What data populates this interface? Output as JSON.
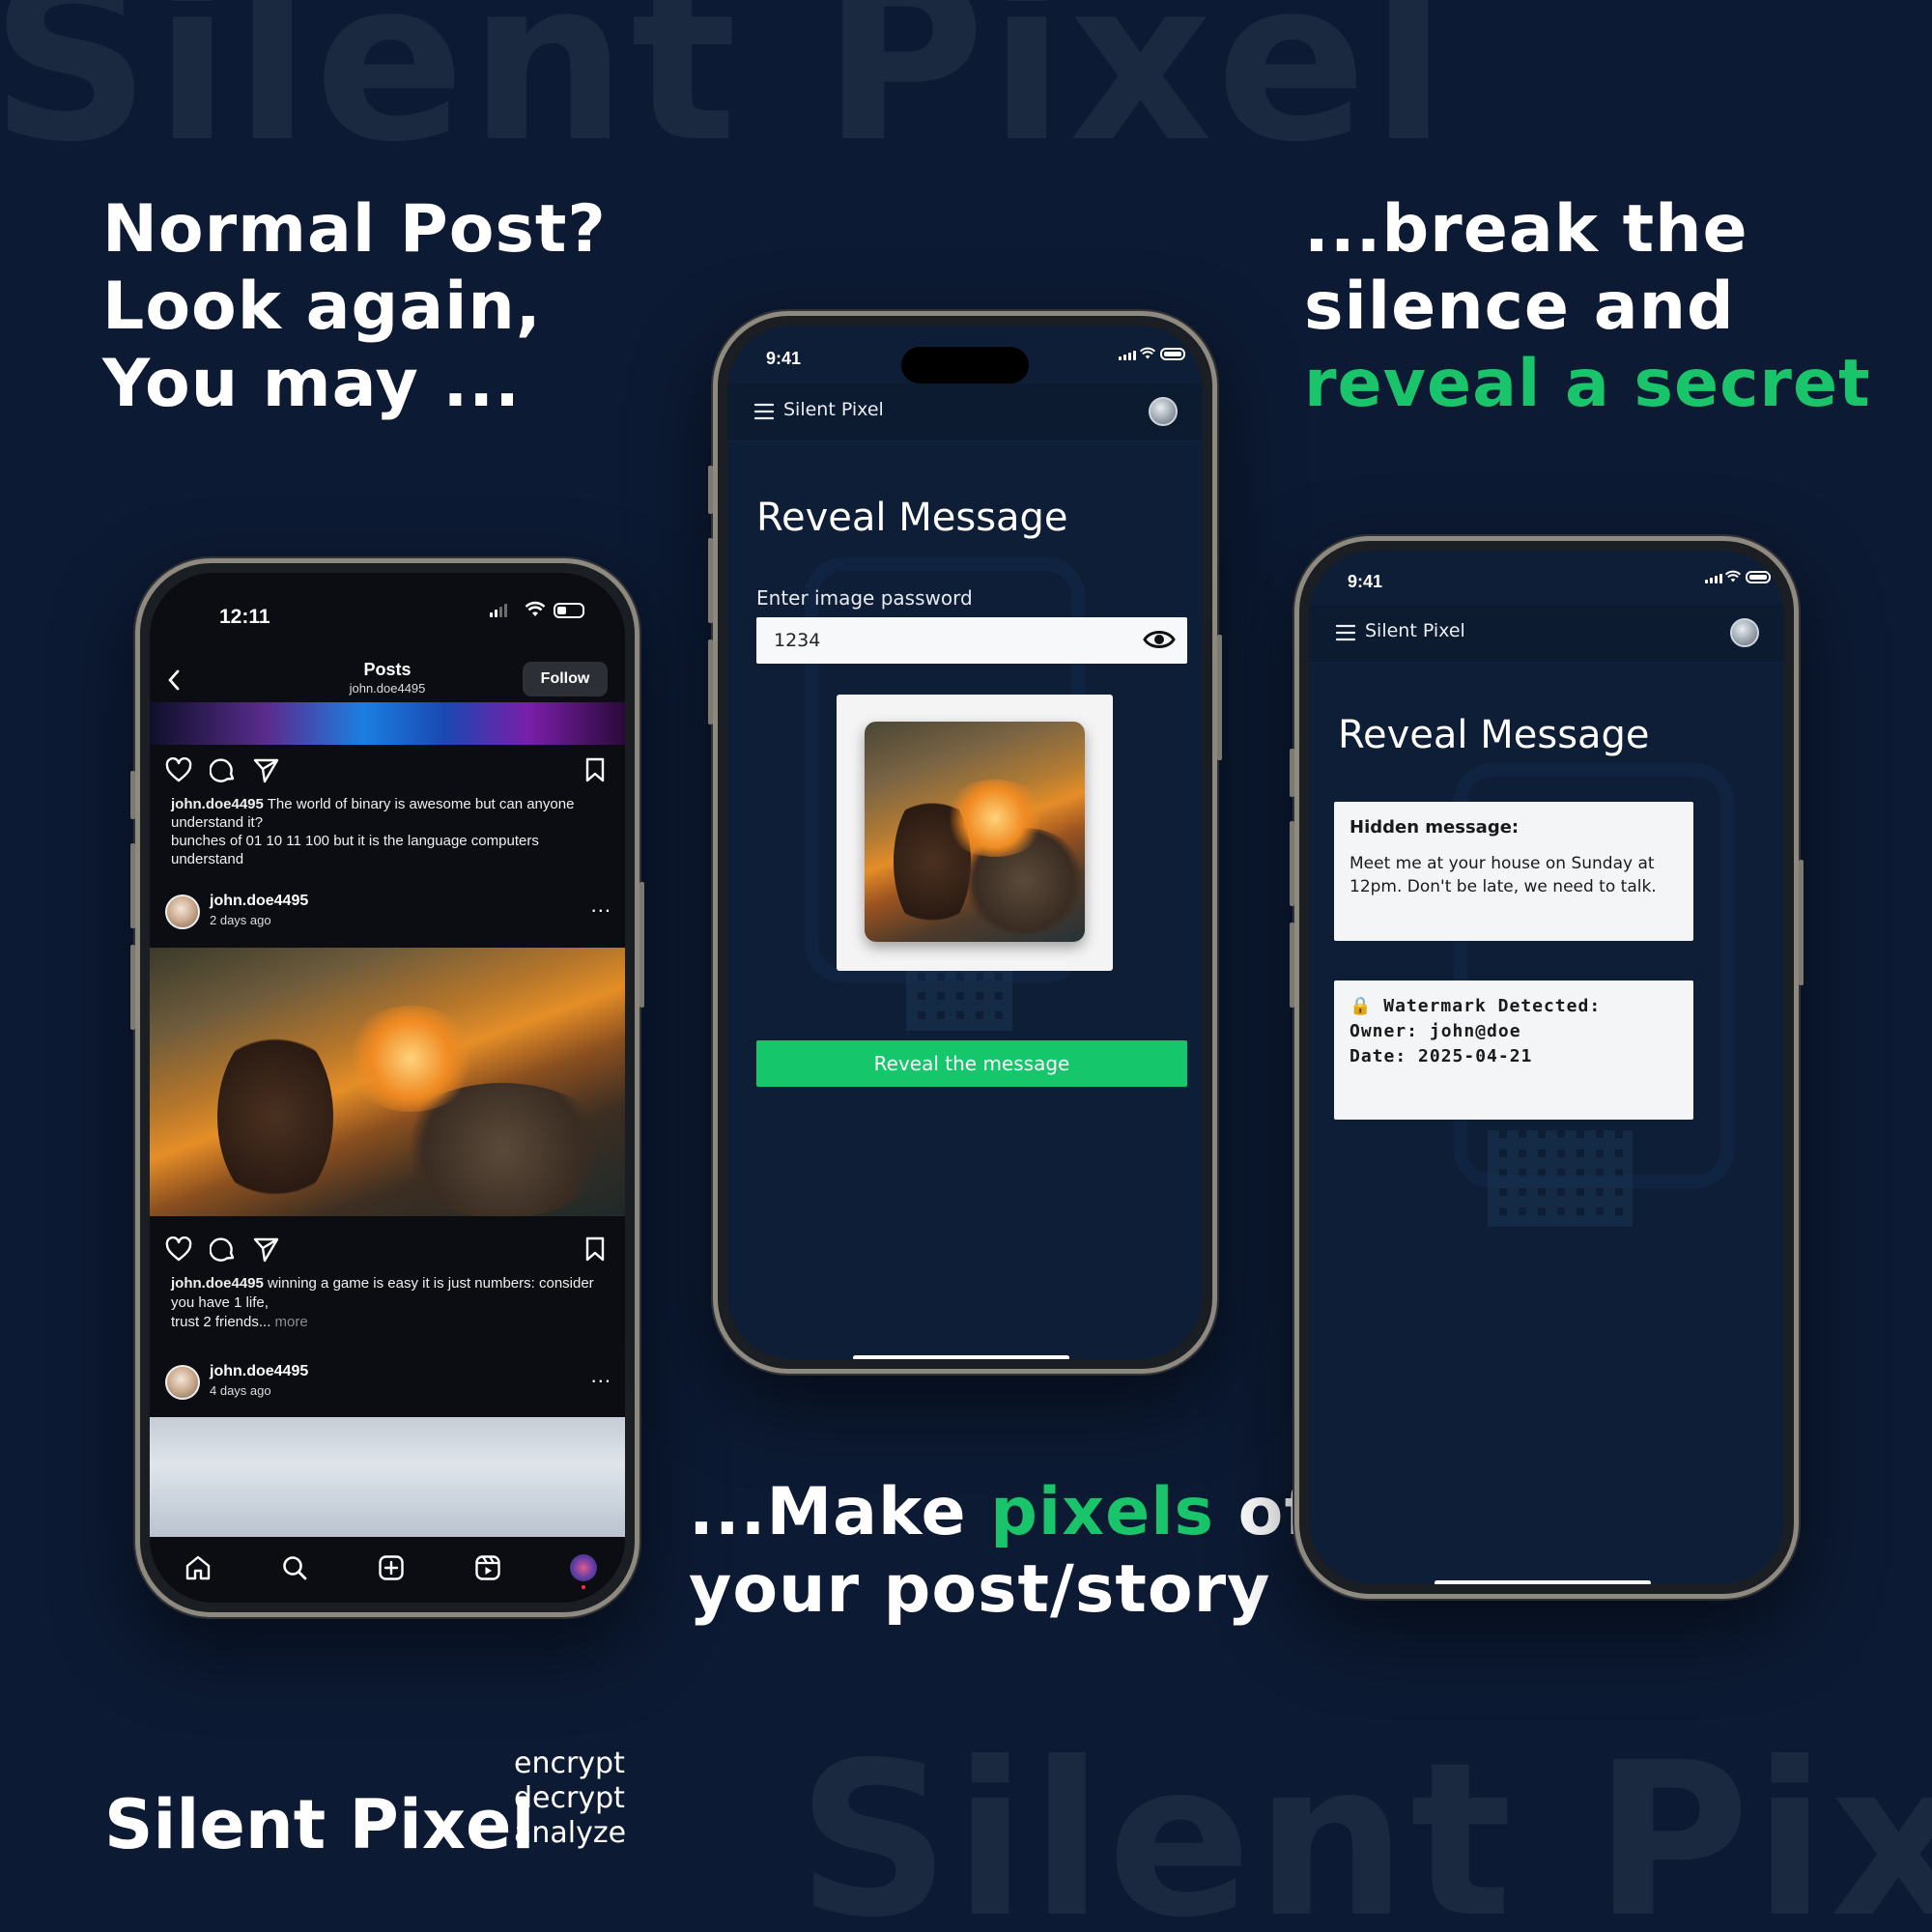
{
  "background": {
    "watermark_top": "Silent Pixel",
    "watermark_bottom": "Silent Pixel",
    "color": "#0c1a33"
  },
  "headlines": {
    "left": [
      "Normal Post?",
      "Look again,",
      "You may ..."
    ],
    "right_line1": "...break the",
    "right_line2": "silence and",
    "right_line3": "reveal a secret",
    "bottom_prefix": "...Make ",
    "bottom_green": "pixels",
    "bottom_suffix": " of",
    "bottom_line2": "your post/story",
    "accent_color": "#19c46a"
  },
  "brand": {
    "name": "Silent Pixel",
    "taglines": [
      "encrypt",
      "decrypt",
      "analyze"
    ]
  },
  "phone_instagram": {
    "time": "12:11",
    "header_title": "Posts",
    "header_subtitle": "john.doe4495",
    "follow_label": "Follow",
    "post1_caption_user": "john.doe4495",
    "post1_caption_text": " The world of binary is awesome but can anyone understand it?",
    "post1_caption_line2": "bunches of 01 10 11 100 but it is the language computers understand",
    "post2_user": "john.doe4495",
    "post2_time": "2 days ago",
    "post2_caption_user": "john.doe4495",
    "post2_caption_text": " winning a game is easy it is just numbers: consider you have 1 life,",
    "post2_caption_line2": "trust 2 friends... ",
    "post2_more": "more",
    "post3_user": "john.doe4495",
    "post3_time": "4 days ago",
    "more_dots": "...",
    "tab_icons": [
      "home-icon",
      "search-icon",
      "add-post-icon",
      "reels-icon",
      "profile-icon"
    ]
  },
  "phone_reveal_input": {
    "time": "9:41",
    "app_title": "Silent Pixel",
    "page_title": "Reveal Message",
    "password_label": "Enter image password",
    "password_value": "1234",
    "button_label": "Reveal the message"
  },
  "phone_reveal_result": {
    "time": "9:41",
    "app_title": "Silent Pixel",
    "page_title": "Reveal Message",
    "hidden_heading": "Hidden message:",
    "hidden_body": "Meet me at your house on Sunday at 12pm. Don't be late, we need to talk.",
    "watermark_heading": "🔒 Watermark Detected:",
    "watermark_owner": "Owner: john@doe",
    "watermark_date": "Date: 2025-04-21"
  }
}
